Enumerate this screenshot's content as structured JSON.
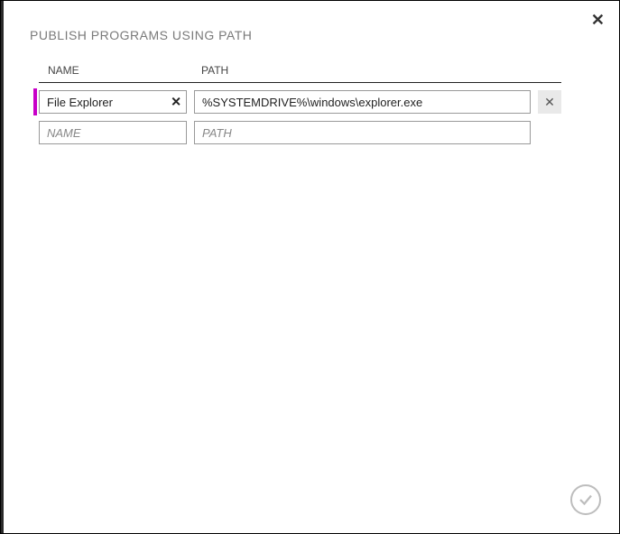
{
  "dialog": {
    "title": "PUBLISH PROGRAMS USING PATH",
    "columns": {
      "name": "NAME",
      "path": "PATH"
    },
    "close_glyph": "✕"
  },
  "rows": [
    {
      "name_value": "File Explorer",
      "path_value": "%SYSTEMDRIVE%\\windows\\explorer.exe",
      "clear_glyph": "✕",
      "remove_glyph": "✕"
    }
  ],
  "empty_row": {
    "name_placeholder": "NAME",
    "path_placeholder": "PATH"
  }
}
